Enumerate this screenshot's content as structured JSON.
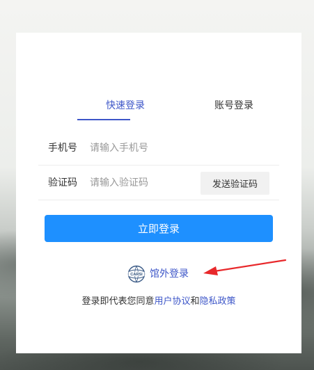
{
  "tabs": {
    "quick_login": "快速登录",
    "account_login": "账号登录"
  },
  "phone_row": {
    "label": "手机号",
    "placeholder": "请输入手机号"
  },
  "code_row": {
    "label": "验证码",
    "placeholder": "请输入验证码",
    "send_button": "发送验证码"
  },
  "login_button": "立即登录",
  "external_login": {
    "icon_text": "CARSI",
    "label": "馆外登录"
  },
  "agreement": {
    "prefix": "登录即代表您同意",
    "user_agreement": "用户协议",
    "and": "和",
    "privacy_policy": "隐私政策"
  },
  "colors": {
    "accent": "#3d56c8",
    "primary_button": "#1e90ff",
    "annotation_arrow": "#e8282b"
  }
}
